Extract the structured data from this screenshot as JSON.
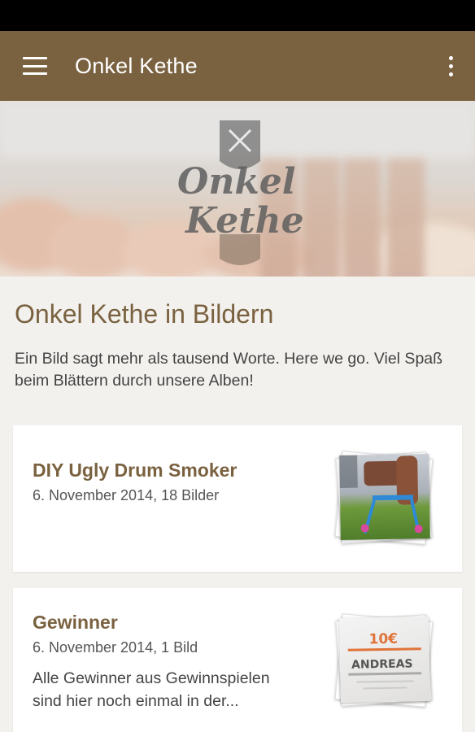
{
  "app_bar": {
    "title": "Onkel Kethe",
    "menu_icon": "hamburger-menu-icon",
    "overflow_icon": "more-vert-icon",
    "background_color": "#7a6240"
  },
  "hero": {
    "logo_line1": "Onkel",
    "logo_line2": "Kethe"
  },
  "section": {
    "title": "Onkel Kethe in Bildern",
    "description": "Ein Bild sagt mehr als tausend Worte. Here we go. Viel Spaß beim Blättern durch unsere Alben!"
  },
  "albums": [
    {
      "title": "DIY Ugly Drum Smoker",
      "meta": "6. November 2014, 18 Bilder"
    },
    {
      "title": "Gewinner",
      "meta": "6. November 2014, 1 Bild",
      "description": "Alle Gewinner aus Gewinnspielen sind hier noch einmal in der...",
      "thumb_price": "10€",
      "thumb_name": "ANDREAS"
    }
  ],
  "colors": {
    "accent": "#7a6240",
    "background": "#f3f1ee",
    "status_bar": "#000000"
  }
}
